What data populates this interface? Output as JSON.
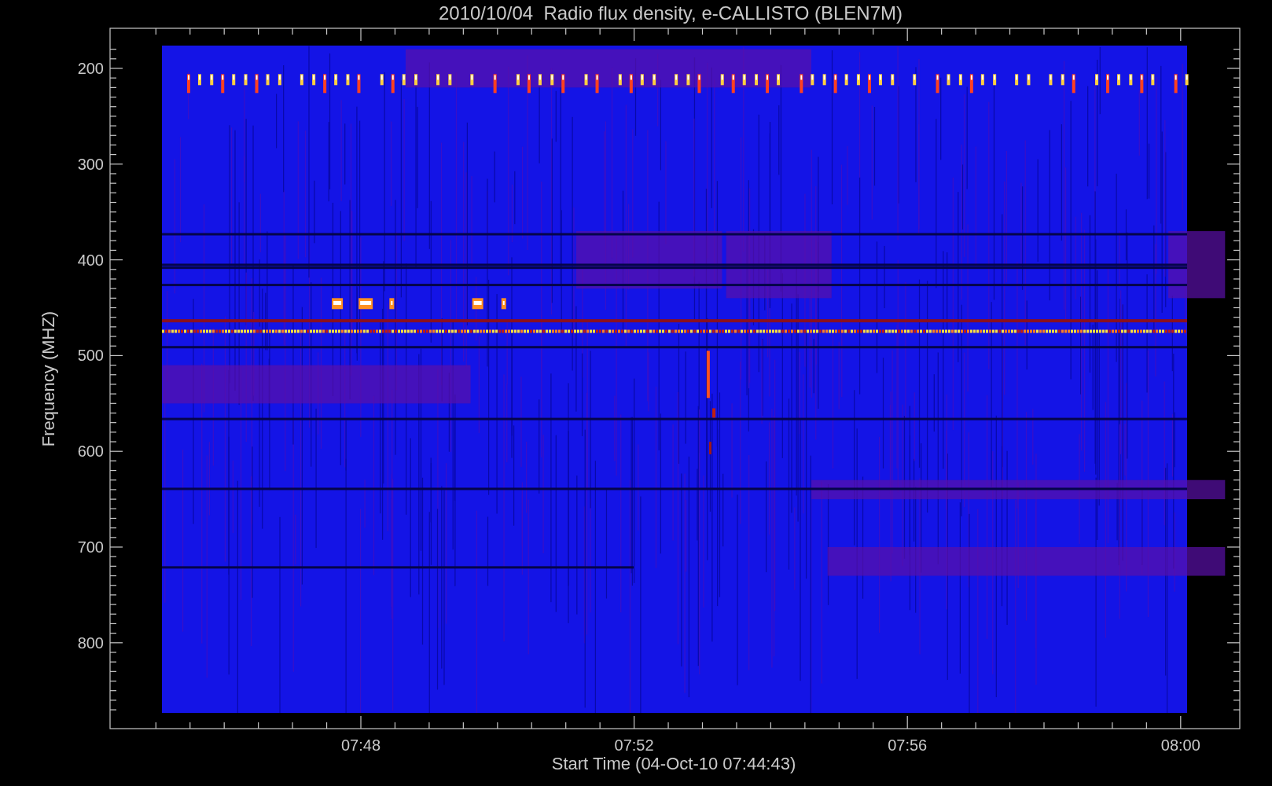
{
  "plot": {
    "title": "2010/10/04  Radio flux density, e-CALLISTO (BLEN7M)",
    "xlabel": "Start Time (04-Oct-10 07:44:43)",
    "ylabel": "Frequency (MHZ)",
    "yticks": [
      "200",
      "300",
      "400",
      "500",
      "600",
      "700",
      "800"
    ],
    "xticks": [
      "07:48",
      "07:52",
      "07:56",
      "08:00"
    ]
  }
}
